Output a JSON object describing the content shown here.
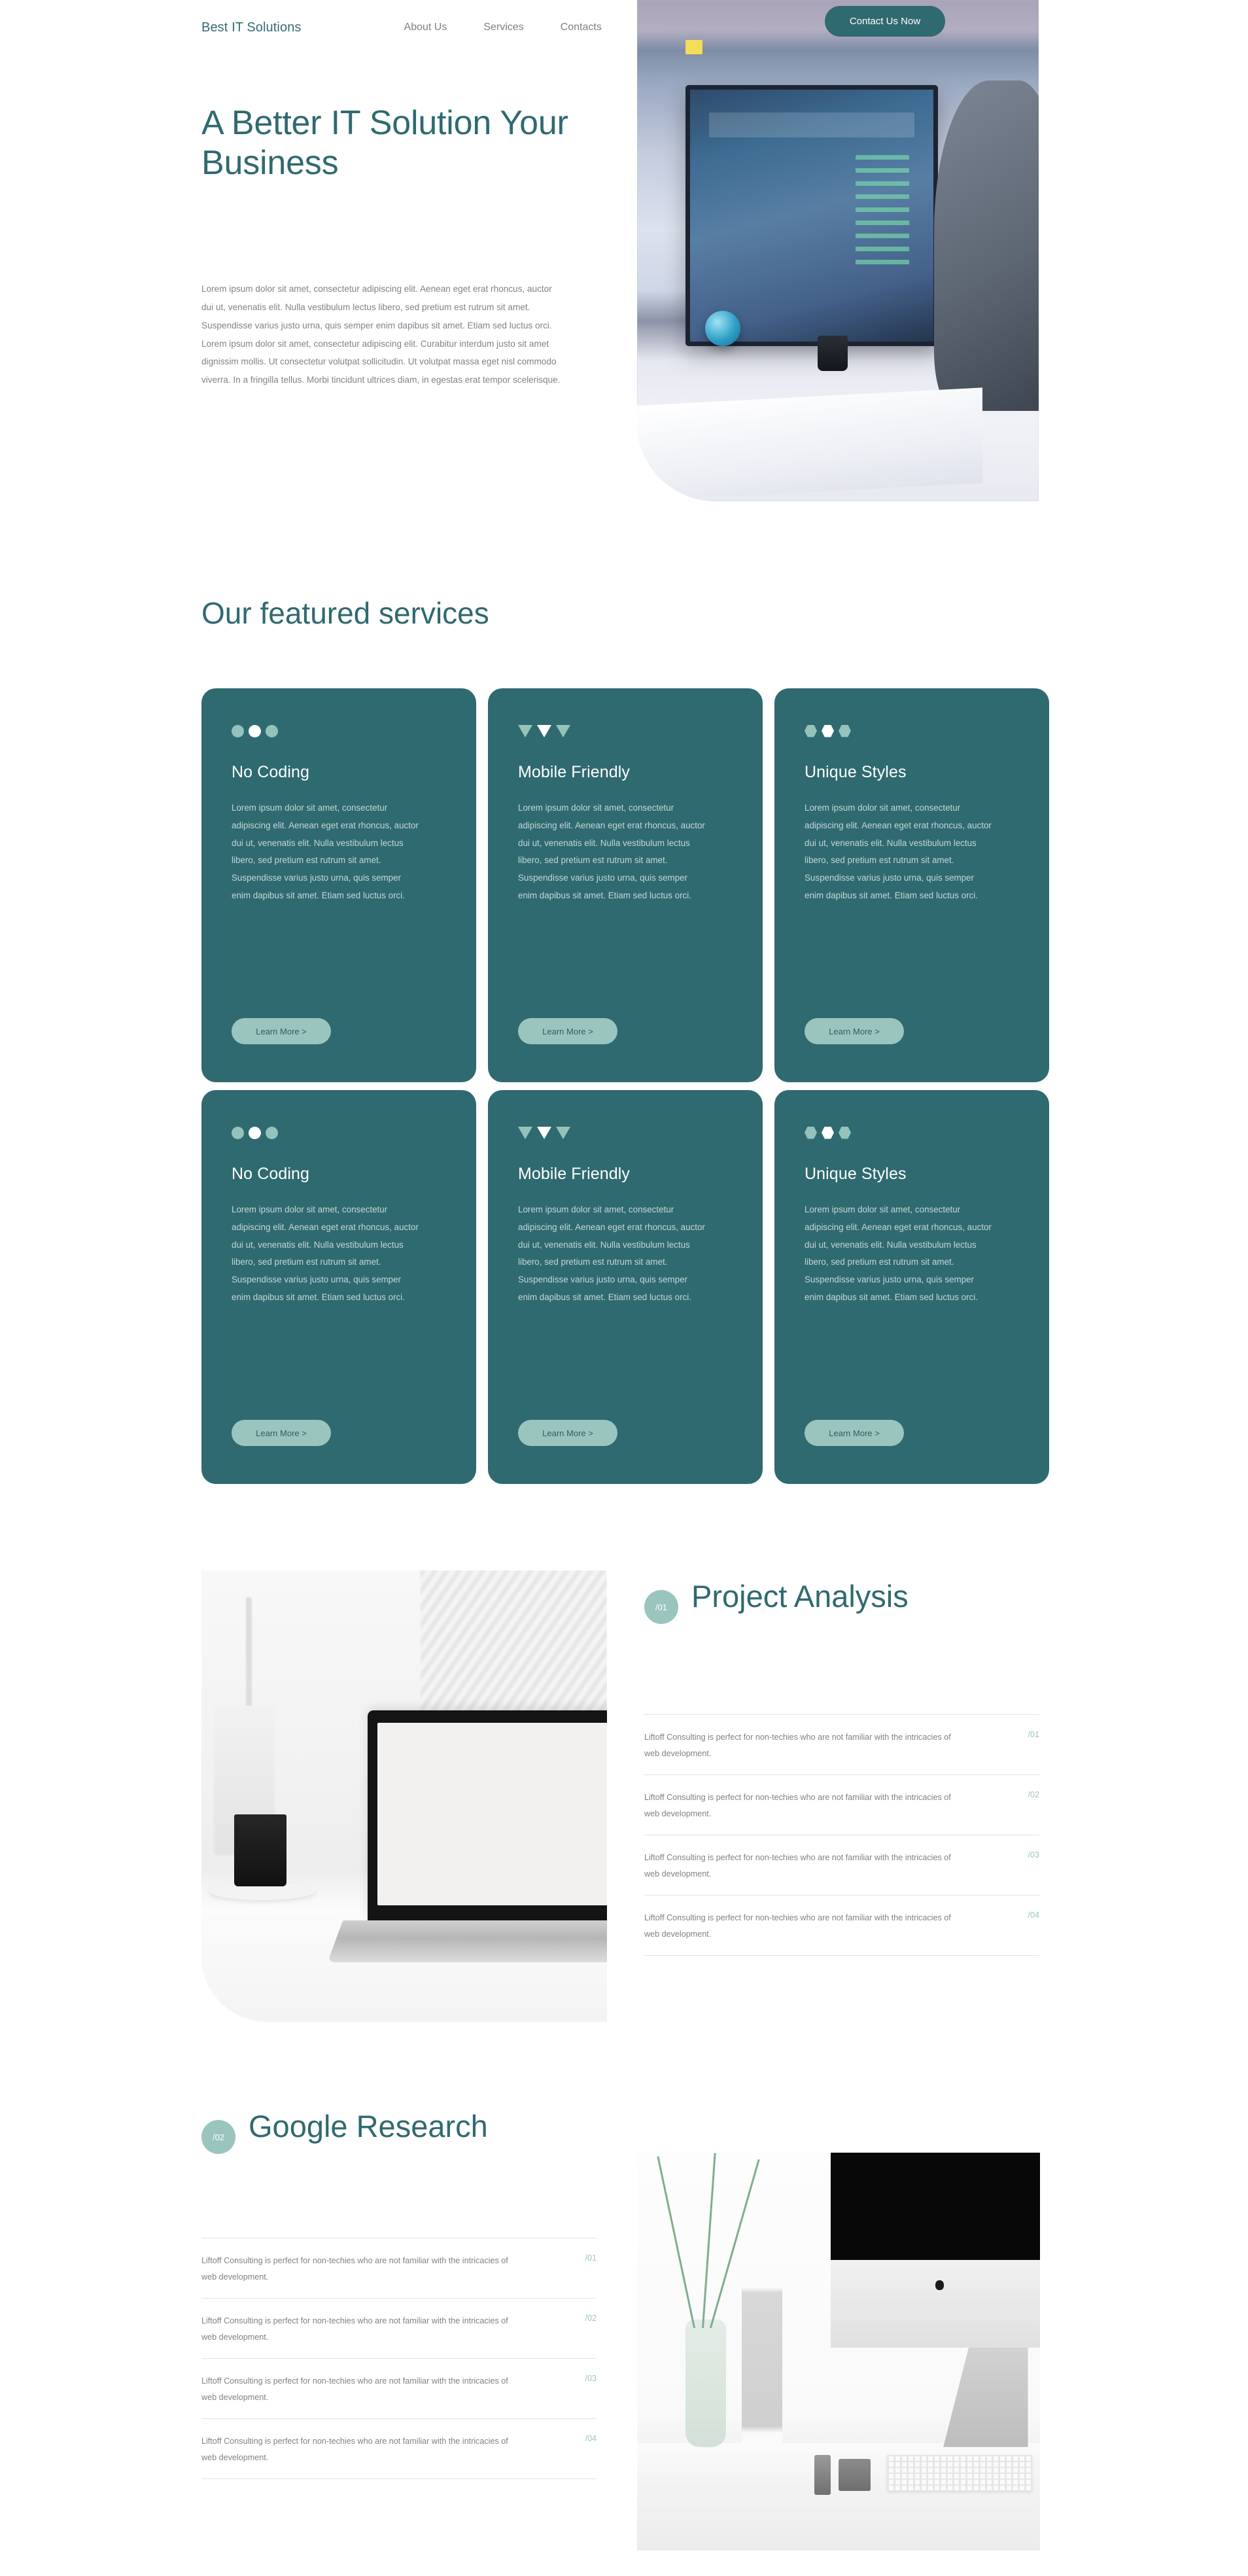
{
  "header": {
    "brand": "Best IT Solutions",
    "nav": [
      {
        "label": "About Us"
      },
      {
        "label": "Services"
      },
      {
        "label": "Contacts"
      }
    ],
    "cta_label": "Contact Us Now"
  },
  "hero": {
    "title": "A Better IT Solution Your Business",
    "paragraph": "Lorem ipsum dolor sit amet, consectetur adipiscing elit. Aenean eget erat rhoncus, auctor dui ut, venenatis elit. Nulla vestibulum lectus libero, sed pretium est rutrum sit amet. Suspendisse varius justo urna, quis semper enim dapibus sit amet. Etiam sed luctus orci. Lorem ipsum dolor sit amet, consectetur adipiscing elit. Curabitur interdum justo sit amet dignissim mollis. Ut consectetur volutpat sollicitudin. Ut volutpat massa eget nisl commodo viverra. In a fringilla tellus. Morbi tincidunt ultrices diam, in egestas erat tempor scelerisque.",
    "image_alt": "desk-with-imac-and-developer-photo"
  },
  "services": {
    "title": "Our featured services",
    "body_text": "Lorem ipsum dolor sit amet, consectetur adipiscing elit. Aenean eget erat rhoncus, auctor dui ut, venenatis elit. Nulla vestibulum lectus libero, sed pretium est rutrum sit amet. Suspendisse varius justo urna, quis semper enim dapibus sit amet. Etiam sed luctus orci.",
    "learn_more_label": "Learn More >",
    "cards": [
      {
        "title": "No Coding",
        "icon": "three-circles-icon"
      },
      {
        "title": "Mobile Friendly",
        "icon": "three-triangles-icon"
      },
      {
        "title": "Unique Styles",
        "icon": "three-hexagons-icon"
      },
      {
        "title": "No Coding",
        "icon": "three-circles-icon"
      },
      {
        "title": "Mobile Friendly",
        "icon": "three-triangles-icon"
      },
      {
        "title": "Unique Styles",
        "icon": "three-hexagons-icon"
      }
    ]
  },
  "features": [
    {
      "badge": "/01",
      "title": "Project Analysis",
      "image_alt": "macbook-pro-on-white-desk-photo",
      "items": [
        {
          "text": "Liftoff Consulting is perfect for non-techies who are not familiar with the intricacies of web development.",
          "num": "/01"
        },
        {
          "text": "Liftoff Consulting is perfect for non-techies who are not familiar with the intricacies of web development.",
          "num": "/02"
        },
        {
          "text": "Liftoff Consulting is perfect for non-techies who are not familiar with the intricacies of web development.",
          "num": "/03"
        },
        {
          "text": "Liftoff Consulting is perfect for non-techies who are not familiar with the intricacies of web development.",
          "num": "/04"
        }
      ]
    },
    {
      "badge": "/02",
      "title": "Google Research",
      "image_alt": "imac-with-plant-and-speaker-photo",
      "items": [
        {
          "text": "Liftoff Consulting is perfect for non-techies who are not familiar with the intricacies of web development.",
          "num": "/01"
        },
        {
          "text": "Liftoff Consulting is perfect for non-techies who are not familiar with the intricacies of web development.",
          "num": "/02"
        },
        {
          "text": "Liftoff Consulting is perfect for non-techies who are not familiar with the intricacies of web development.",
          "num": "/03"
        },
        {
          "text": "Liftoff Consulting is perfect for non-techies who are not familiar with the intricacies of web development.",
          "num": "/04"
        }
      ]
    }
  ],
  "colors": {
    "brand_teal": "#2f6a70",
    "muted_green": "#9ac5bf",
    "body_gray": "#7d8389",
    "card_body": "#c3d7d8",
    "divider": "#dfe4e4"
  }
}
